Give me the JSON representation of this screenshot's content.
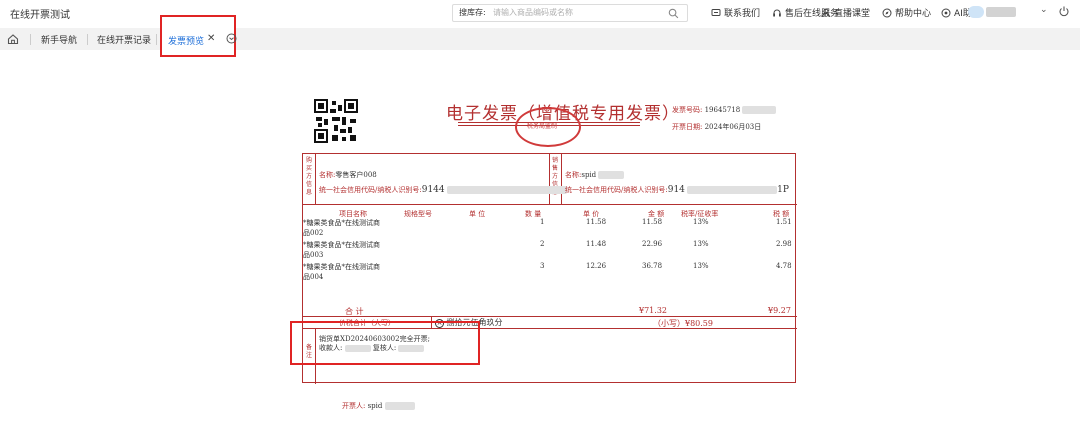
{
  "header": {
    "app_title": "在线开票测试",
    "search_label": "搜库存:",
    "search_placeholder": "请输入商品编码或名称",
    "links": [
      "联系我们",
      "售后在线服务",
      "直播课堂",
      "帮助中心",
      "AI助手"
    ]
  },
  "tabs": {
    "items": [
      "新手导航",
      "在线开票记录"
    ],
    "active": "发票预览"
  },
  "invoice": {
    "title": "电子发票（增值税专用发票）",
    "seal_text": "税务局监制",
    "number_label": "发票号码:",
    "number_value": "19645718",
    "date_label": "开票日期:",
    "date_value": "2024年06月03日",
    "buyer_side_label": "购买方信息",
    "seller_side_label": "销售方信息",
    "buyer_name_label": "名称:",
    "buyer_name": "零售客户008",
    "buyer_tax_label": "统一社会信用代码/纳税人识别号:",
    "buyer_tax": "9144",
    "seller_name_label": "名称:",
    "seller_name": "spid",
    "seller_tax_label": "统一社会信用代码/纳税人识别号:",
    "seller_tax": "914",
    "seller_tax_tail": "1P",
    "columns": [
      "项目名称",
      "规格型号",
      "单 位",
      "数 量",
      "单 价",
      "金 额",
      "税率/征收率",
      "税 额"
    ],
    "rows": [
      {
        "name1": "*糖果类食品*在线测试商",
        "name2": "品002",
        "qty": "1",
        "price": "11.58",
        "amount": "11.58",
        "rate": "13%",
        "tax": "1.51"
      },
      {
        "name1": "*糖果类食品*在线测试商",
        "name2": "品003",
        "qty": "2",
        "price": "11.48",
        "amount": "22.96",
        "rate": "13%",
        "tax": "2.98"
      },
      {
        "name1": "*糖果类食品*在线测试商",
        "name2": "品004",
        "qty": "3",
        "price": "12.26",
        "amount": "36.78",
        "rate": "13%",
        "tax": "4.78"
      }
    ],
    "sum_label": "合    计",
    "sum_amount": "¥71.32",
    "sum_tax": "¥9.27",
    "total_label": "价税合计（大写）",
    "total_words": "捌拾元伍角玖分",
    "total_small": "（小写）¥80.59",
    "remark_label": "备注",
    "remark_line1": "销货单XD20240603002完全开票;",
    "remark_line2_a": "收款人:",
    "remark_line2_b": "复核人:",
    "issuer_label": "开票人:",
    "issuer_value": "spid"
  },
  "colors": {
    "accent": "#1e6fd9",
    "invoice_red": "#b33030",
    "highlight": "#e02424"
  }
}
